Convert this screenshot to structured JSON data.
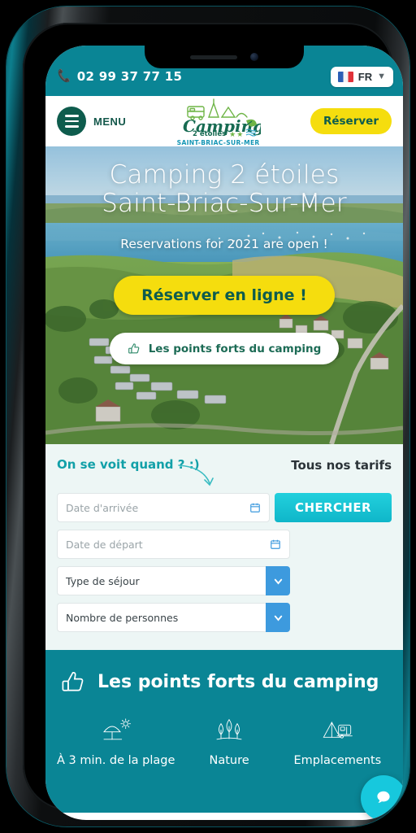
{
  "topbar": {
    "phone": "02 99 37 77 15",
    "phone_icon": "phone-icon",
    "language": "FR",
    "flag_icon": "flag-fr-icon",
    "chevron": "chevron-down-icon"
  },
  "header": {
    "menu_label": "MENU",
    "burger_icon": "hamburger-icon",
    "reserve_label": "Réserver",
    "logo": {
      "name": "Camping",
      "stars_line": "2 étoiles",
      "location": "SAINT-BRIAC-SUR-MER",
      "stars": 2
    }
  },
  "hero": {
    "title_line1": "Camping 2 étoiles",
    "title_line2": "Saint-Briac-Sur-Mer",
    "subtitle": "Reservations for 2021 are open !",
    "cta_label": "Réserver en ligne !",
    "secondary_label": "Les points forts du camping",
    "secondary_icon": "thumbs-up-icon"
  },
  "booking": {
    "question": "On se voit quand ? :)",
    "arrow_icon": "curved-arrow-down-icon",
    "tarifs_label": "Tous nos tarifs",
    "arrival": {
      "placeholder": "Date d'arrivée",
      "value": "",
      "icon": "calendar-icon"
    },
    "departure": {
      "placeholder": "Date de départ",
      "value": "",
      "icon": "calendar-icon"
    },
    "stay_type": {
      "placeholder": "Type de séjour",
      "value": "",
      "icon": "chevron-down-icon"
    },
    "persons": {
      "placeholder": "Nombre de personnes",
      "value": "",
      "icon": "chevron-down-icon"
    },
    "search_label": "CHERCHER"
  },
  "highlights": {
    "title": "Les points forts du camping",
    "title_icon": "thumbs-up-icon",
    "items": [
      {
        "label": "À 3 min. de la plage",
        "icon": "beach-parasol-icon"
      },
      {
        "label": "Nature",
        "icon": "trees-icon"
      },
      {
        "label": "Emplacements",
        "icon": "tent-caravan-icon"
      }
    ]
  },
  "chat": {
    "icon": "chat-bubble-icon"
  },
  "colors": {
    "teal": "#0a8595",
    "dark_green": "#0e5c4d",
    "yellow": "#f5dd0e",
    "cyan": "#17c8dd",
    "mint_bg": "#edf6f5",
    "blue_select": "#3d9ade"
  }
}
